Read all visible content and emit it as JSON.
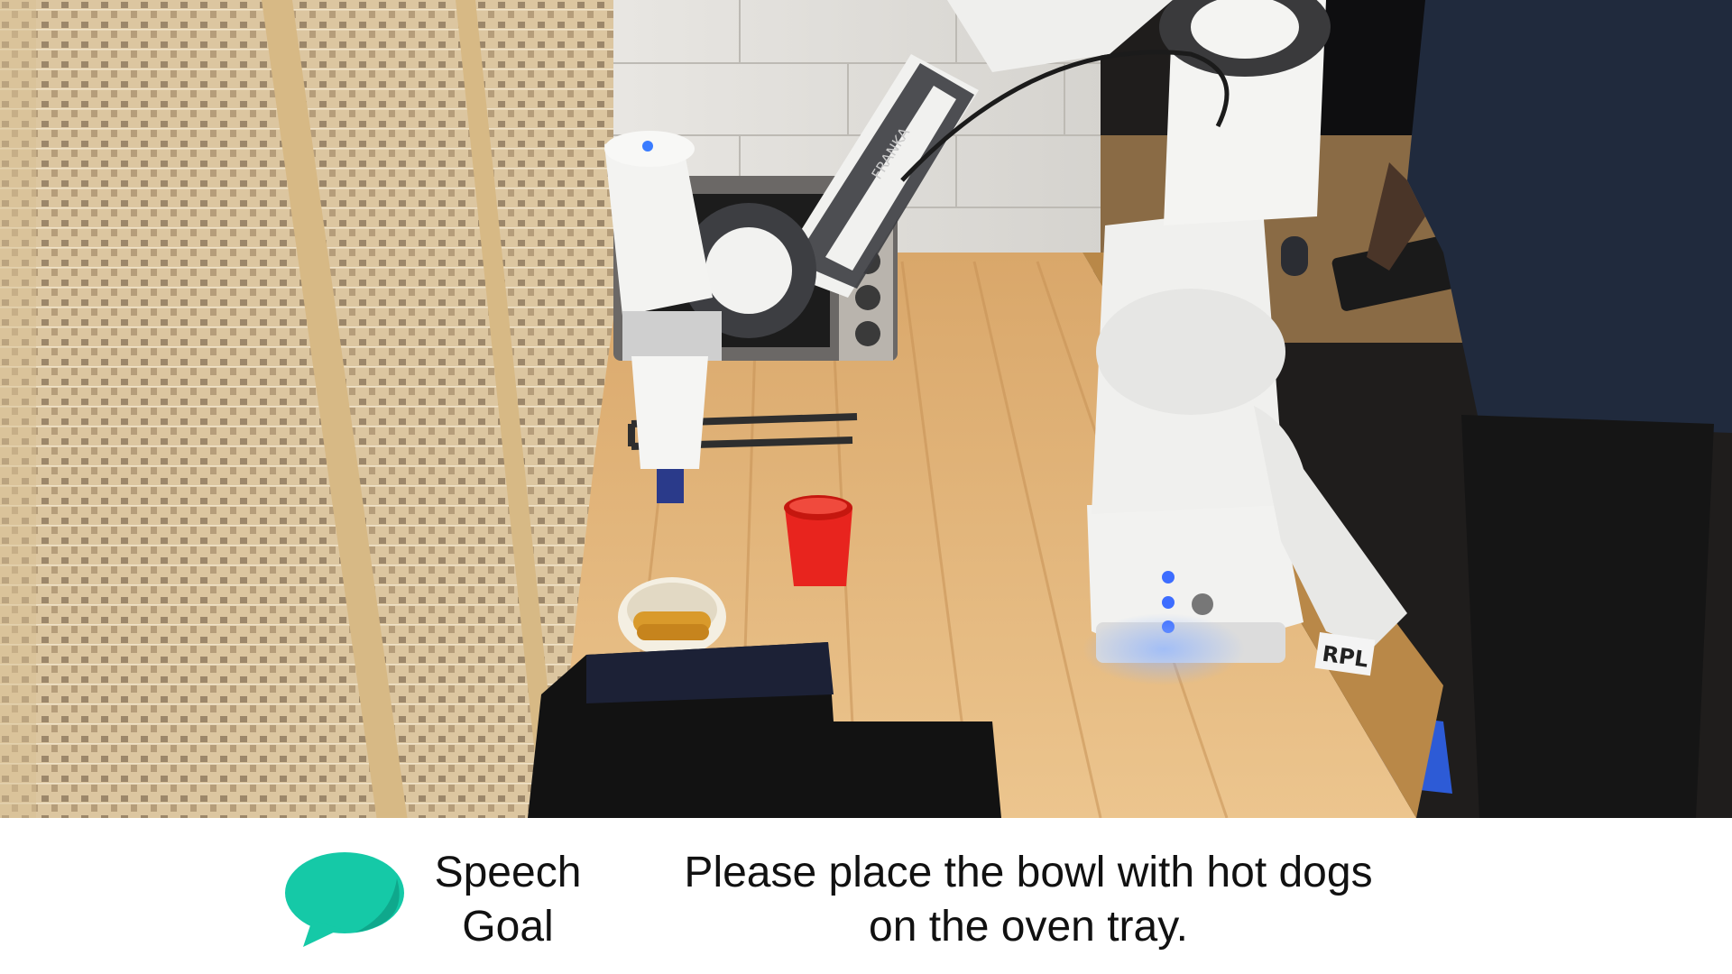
{
  "caption": {
    "icon": "speech-bubble-icon",
    "icon_color": "#15c9a7",
    "label_lines": [
      "Speech",
      "Goal"
    ],
    "instruction_lines": [
      "Please place the bowl with hot dogs",
      "on the oven tray."
    ]
  },
  "scene": {
    "cup_color": "#e8241e",
    "bowl_color": "#f4efe2",
    "hotdog_color": "#d99a2b",
    "robot_color": "#f2f2f0",
    "counter_color": "#e2b67c",
    "robot_brand_label": "FRANKA",
    "tag_label": "RPL"
  }
}
